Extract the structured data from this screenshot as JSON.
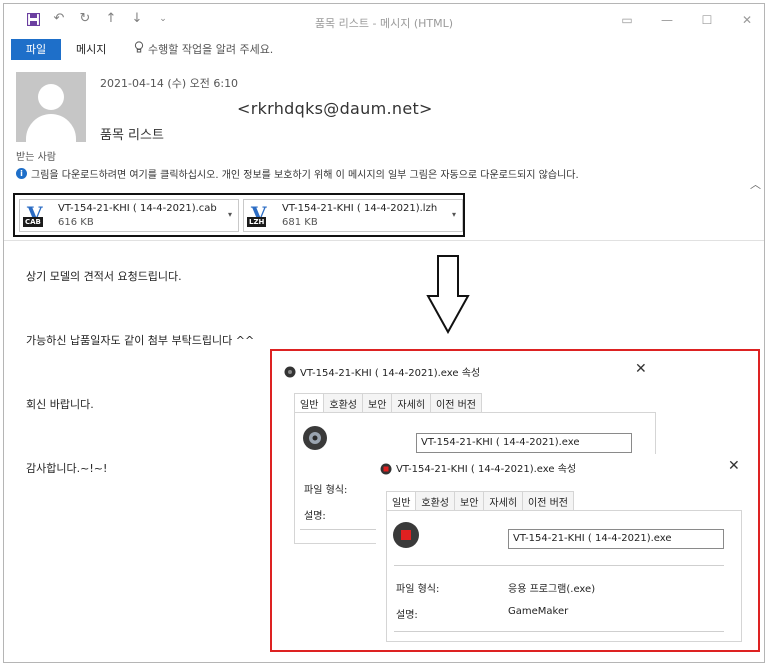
{
  "window": {
    "title": "품목 리스트 - 메시지 (HTML)"
  },
  "ribbon": {
    "file_tab": "파일",
    "message_tab": "메시지",
    "tell_me": "수행할 작업을 알려 주세요."
  },
  "header": {
    "date": "2021-04-14 (수) 오전 6:10",
    "sender": "<rkrhdqks@daum.net>",
    "subject": "품목 리스트",
    "recipient_label": "받는 사람",
    "info_bar": "그림을 다운로드하려면 여기를 클릭하십시오. 개인 정보를 보호하기 위해 이 메시지의 일부 그림은 자동으로 다운로드되지 않습니다."
  },
  "attachments": [
    {
      "name": "VT-154-21-KHI ( 14-4-2021).cab",
      "size": "616 KB",
      "type_tag": "CAB"
    },
    {
      "name": "VT-154-21-KHI ( 14-4-2021).lzh",
      "size": "681 KB",
      "type_tag": "LZH"
    }
  ],
  "body": {
    "line1": "상기 모델의 견적서 요청드립니다.",
    "line2": "가능하신 납품일자도 같이 첨부 부탁드립니다 ^^",
    "line3": "회신 바랍니다.",
    "line4": "감사합니다.~!~!"
  },
  "dialog_back": {
    "title": "VT-154-21-KHI ( 14-4-2021).exe 속성",
    "tabs": [
      "일반",
      "호환성",
      "보안",
      "자세히",
      "이전 버전"
    ],
    "filename": "VT-154-21-KHI ( 14-4-2021).exe",
    "file_type_label": "파일 형식:",
    "description_label": "설명:"
  },
  "dialog_front": {
    "title": "VT-154-21-KHI ( 14-4-2021).exe 속성",
    "tabs": [
      "일반",
      "호환성",
      "보안",
      "자세히",
      "이전 버전"
    ],
    "filename": "VT-154-21-KHI ( 14-4-2021).exe",
    "file_type_label": "파일 형식:",
    "file_type_value": "응용 프로그램(.exe)",
    "description_label": "설명:",
    "description_value": "GameMaker"
  },
  "colors": {
    "accent": "#1e6fc9",
    "highlight_border": "#dd2222",
    "attachment_border": "#111111"
  }
}
